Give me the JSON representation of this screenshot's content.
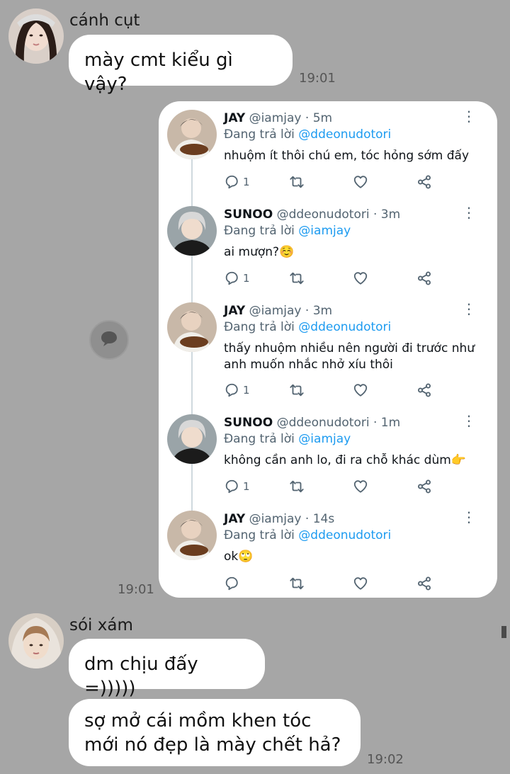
{
  "messages": [
    {
      "sender": "cánh cụt",
      "bubbles": [
        "mày cmt kiểu gì vậy?"
      ],
      "time": "19:01"
    },
    {
      "time": "19:01",
      "shared_tweet": {
        "tweets": [
          {
            "name": "JAY",
            "handle": "@iamjay",
            "age": "5m",
            "reply_prefix": "Đang trả lời",
            "reply_to": "@ddeonudotori",
            "text": "nhuộm ít thôi chú em, tóc hỏng sớm đấy",
            "replies": "1"
          },
          {
            "name": "SUNOO",
            "handle": "@ddeonudotori",
            "age": "3m",
            "reply_prefix": "Đang trả lời",
            "reply_to": "@iamjay",
            "text": "ai mượn?☺️",
            "replies": "1"
          },
          {
            "name": "JAY",
            "handle": "@iamjay",
            "age": "3m",
            "reply_prefix": "Đang trả lời",
            "reply_to": "@ddeonudotori",
            "text": "thấy nhuộm nhiều nên người đi trước như anh muốn nhắc nhở xíu thôi",
            "replies": "1"
          },
          {
            "name": "SUNOO",
            "handle": "@ddeonudotori",
            "age": "1m",
            "reply_prefix": "Đang trả lời",
            "reply_to": "@iamjay",
            "text": "không cần anh lo, đi ra chỗ khác dùm👉",
            "replies": "1"
          },
          {
            "name": "JAY",
            "handle": "@iamjay",
            "age": "14s",
            "reply_prefix": "Đang trả lời",
            "reply_to": "@ddeonudotori",
            "text": "ok🙄",
            "replies": ""
          }
        ]
      }
    },
    {
      "sender": "sói xám",
      "bubbles": [
        "dm chịu đấy =)))))",
        "sợ mở cái mồm khen tóc mới nó đẹp là mày chết hả?"
      ],
      "time": "19:02"
    }
  ],
  "icons": {
    "share_button": "speech-bubble-icon",
    "reply": "reply-icon",
    "retweet": "retweet-icon",
    "like": "heart-icon",
    "share": "share-icon",
    "more": "more-vertical-icon"
  },
  "colors": {
    "background": "#a6a6a6",
    "bubble": "#ffffff",
    "mention": "#1d9bf0",
    "muted": "#536471"
  }
}
